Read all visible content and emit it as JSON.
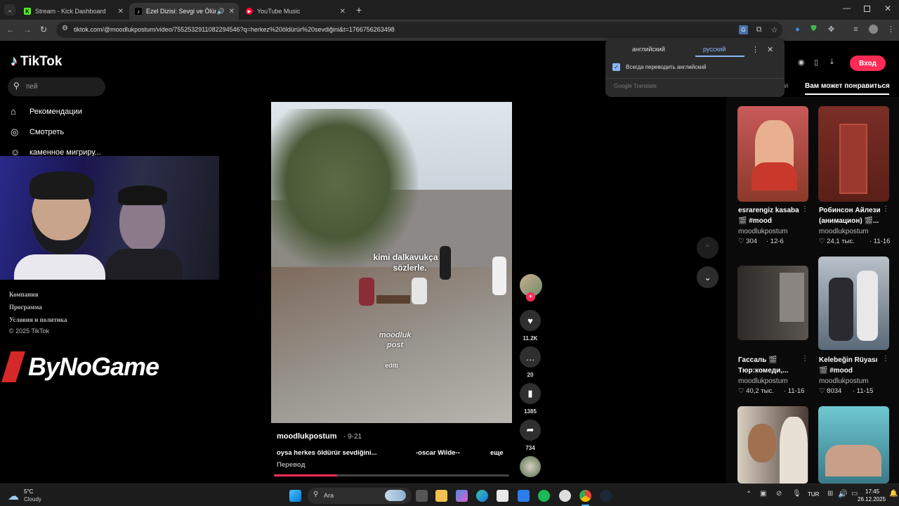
{
  "browser": {
    "tabs": [
      {
        "title": "Stream - Kick Dashboard",
        "favicon": "K",
        "color": "#53fc18"
      },
      {
        "title": "Ezel Dizisi: Sevgi ve Ölüm (",
        "favicon": "♪",
        "color": "#ffffff"
      },
      {
        "title": "YouTube Music",
        "favicon": "▶",
        "color": "#ff0033"
      }
    ],
    "new_tab": "+",
    "url": "tiktok.com/@moodlukpostum/video/7552532911082294546?q=herkez%20öldürür%20sevdiğini&t=1766756263498"
  },
  "translate": {
    "lang_source": "английский",
    "lang_target": "русский",
    "always_translate": "Всегда переводить английский",
    "brand": "Google Translate"
  },
  "tiktok": {
    "logo": "TikTok",
    "search_text": "пей",
    "nav": [
      {
        "label": "Рекомендации",
        "icon": "home-icon"
      },
      {
        "label": "Смотреть",
        "icon": "compass-icon"
      },
      {
        "label": "каменное мигриру...",
        "icon": "person-icon"
      }
    ],
    "footer": [
      "Компания",
      "Программа",
      "Условия и политика",
      "© 2025 TikTok"
    ],
    "login_label": "Вход",
    "tab_partial": "ии",
    "tab_recommend": "Вам может понравиться",
    "video": {
      "caption_top": "kimi dalkavukça",
      "caption_bottom": "sözlerle.",
      "watermark1": "moodluk",
      "watermark2": "post",
      "watermark3": "editi",
      "author": "moodlukpostum",
      "date": "· 9-21",
      "desc": "oysa herkes öldürür sevdiğini...",
      "quote": "-oscar Wilde--",
      "more": "еще",
      "translate": "Перевод",
      "progress": 0.27
    },
    "actions": {
      "likes": "11.2K",
      "comments": "20",
      "saves": "1385",
      "shares": "734"
    },
    "cards": [
      {
        "title": "esrarengiz kasaba 🎬 #mood",
        "user": "moodlukpostum",
        "likes": "♡ 304",
        "date": "· 12-6"
      },
      {
        "title": "Робинсон Айлези (анимацион) 🎬...",
        "user": "moodlukpostum",
        "likes": "♡ 24,1 тыс.",
        "date": "· 11-16"
      },
      {
        "title": "Гассаль 🎬 Тюр:комеди,...",
        "user": "moodlukpostum",
        "likes": "♡ 40,2 тыс.",
        "date": "· 11-16"
      },
      {
        "title": "Kelebeğin Rüyası 🎬 #mood",
        "user": "moodlukpostum",
        "likes": "♡ 8034",
        "date": "· 11-15"
      }
    ]
  },
  "overlay": {
    "brand": "ByNoGame"
  },
  "taskbar": {
    "temp": "5°C",
    "weather": "Cloudy",
    "search": "Ara",
    "lang": "TUR",
    "time": "17:45",
    "date": "26.12.2025"
  }
}
